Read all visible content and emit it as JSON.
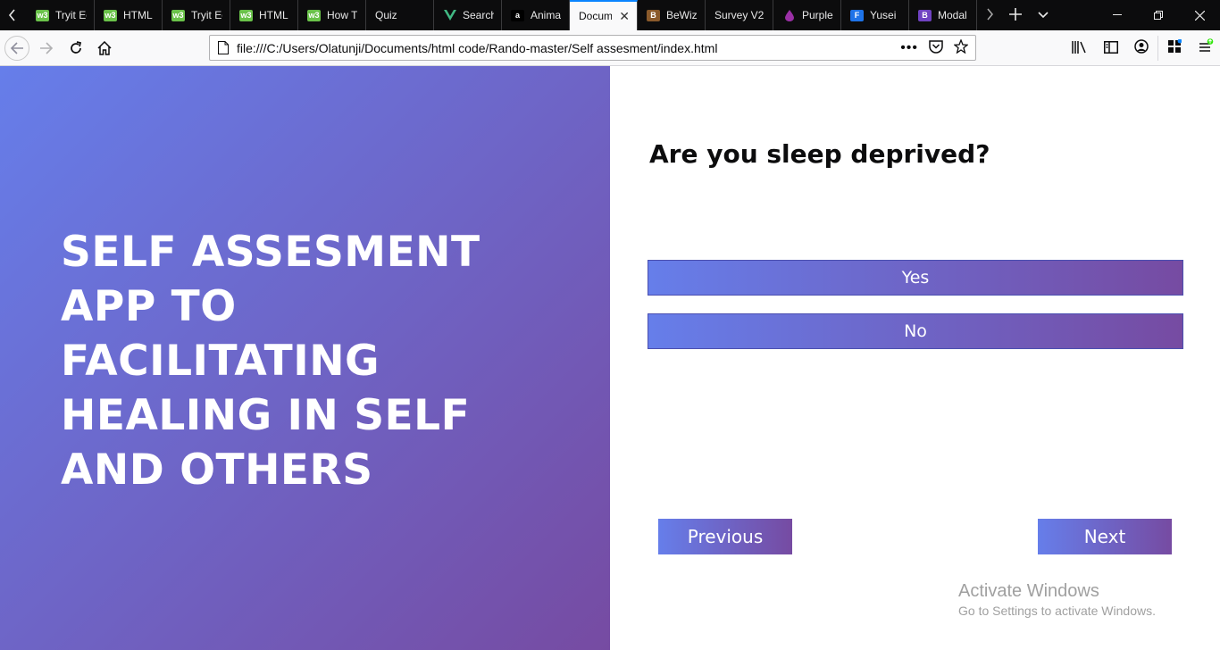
{
  "browser": {
    "tabs": [
      {
        "label": "Tryit Ed",
        "icon": "w3-icon"
      },
      {
        "label": "HTML",
        "icon": "w3-icon"
      },
      {
        "label": "Tryit Ed",
        "icon": "w3-icon"
      },
      {
        "label": "HTML",
        "icon": "w3-icon"
      },
      {
        "label": "How T",
        "icon": "w3-icon"
      },
      {
        "label": "Quiz",
        "icon": "none"
      },
      {
        "label": "Search",
        "icon": "vue-icon"
      },
      {
        "label": "Anima",
        "icon": "amazon-icon"
      },
      {
        "label": "Docum",
        "icon": "none",
        "active": true
      },
      {
        "label": "BeWiz",
        "icon": "bewizard-icon"
      },
      {
        "label": "Survey V2",
        "icon": "none"
      },
      {
        "label": "Purple",
        "icon": "purple-drop-icon"
      },
      {
        "label": "Yusei",
        "icon": "f-icon"
      },
      {
        "label": "Modal",
        "icon": "bootstrap-icon"
      }
    ],
    "url": "file:///C:/Users/Olatunji/Documents/html code/Rando-master/Self assesment/index.html"
  },
  "hero": {
    "title": "SELF ASSESMENT APP TO FACILITATING HEALING IN SELF AND OTHERS"
  },
  "quiz": {
    "question": "Are you sleep deprived?",
    "answers": {
      "yes": "Yes",
      "no": "No"
    },
    "prev_label": "Previous",
    "next_label": "Next"
  },
  "watermark": {
    "title": "Activate Windows",
    "subtitle": "Go to Settings to activate Windows."
  },
  "colors": {
    "gradient_start": "#667eea",
    "gradient_end": "#764ba2"
  }
}
